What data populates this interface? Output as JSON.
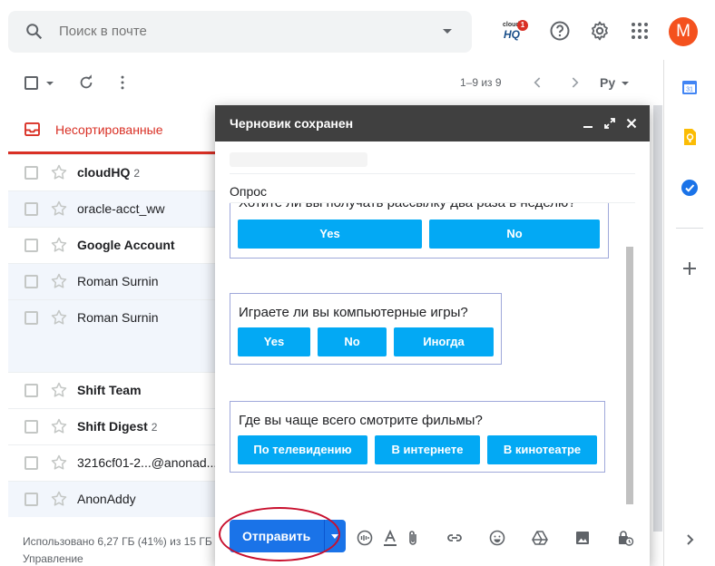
{
  "search": {
    "placeholder": "Поиск в почте"
  },
  "header": {
    "cloudhq_small": "cloud",
    "cloudhq_big": "HQ",
    "cloudhq_badge": "1",
    "avatar_letter": "M"
  },
  "toolbar": {
    "pager": "1–9 из 9",
    "lang": "Ру"
  },
  "tab": {
    "label": "Несортированные"
  },
  "emails": [
    {
      "sender": "cloudHQ",
      "count": "2",
      "bold": true
    },
    {
      "sender": "oracle-acct_ww",
      "count": "",
      "bold": false
    },
    {
      "sender": "Google Account",
      "count": "",
      "bold": true
    },
    {
      "sender": "Roman Surnin",
      "count": "",
      "bold": false
    },
    {
      "sender": "Roman Surnin",
      "count": "",
      "bold": false
    },
    {
      "sender": "Shift Team",
      "count": "",
      "bold": true
    },
    {
      "sender": "Shift Digest",
      "count": "2",
      "bold": true
    },
    {
      "sender": "3216cf01-2...@anonad...",
      "count": "",
      "bold": false
    },
    {
      "sender": "AnonAddy",
      "count": "",
      "bold": false
    }
  ],
  "footer": {
    "storage": "Использовано 6,27 ГБ (41%) из 15 ГБ",
    "manage": "Управление"
  },
  "compose": {
    "title": "Черновик сохранен",
    "subject": "Опрос",
    "send_label": "Отправить",
    "surveys": [
      {
        "question": "Хотите ли вы получать рассылку два раза в неделю?",
        "buttons": [
          "Yes",
          "No"
        ]
      },
      {
        "question": "Играете ли вы компьютерные игры?",
        "buttons": [
          "Yes",
          "No",
          "Иногда"
        ]
      },
      {
        "question": "Где вы чаще всего смотрите фильмы?",
        "buttons": [
          "По телевидению",
          "В интернете",
          "В кинотеатре"
        ]
      }
    ]
  },
  "colors": {
    "accent_red": "#d93025",
    "send_blue": "#1a73e8",
    "survey_button": "#03a9f4",
    "compose_header": "#404040",
    "avatar": "#f4511e"
  }
}
